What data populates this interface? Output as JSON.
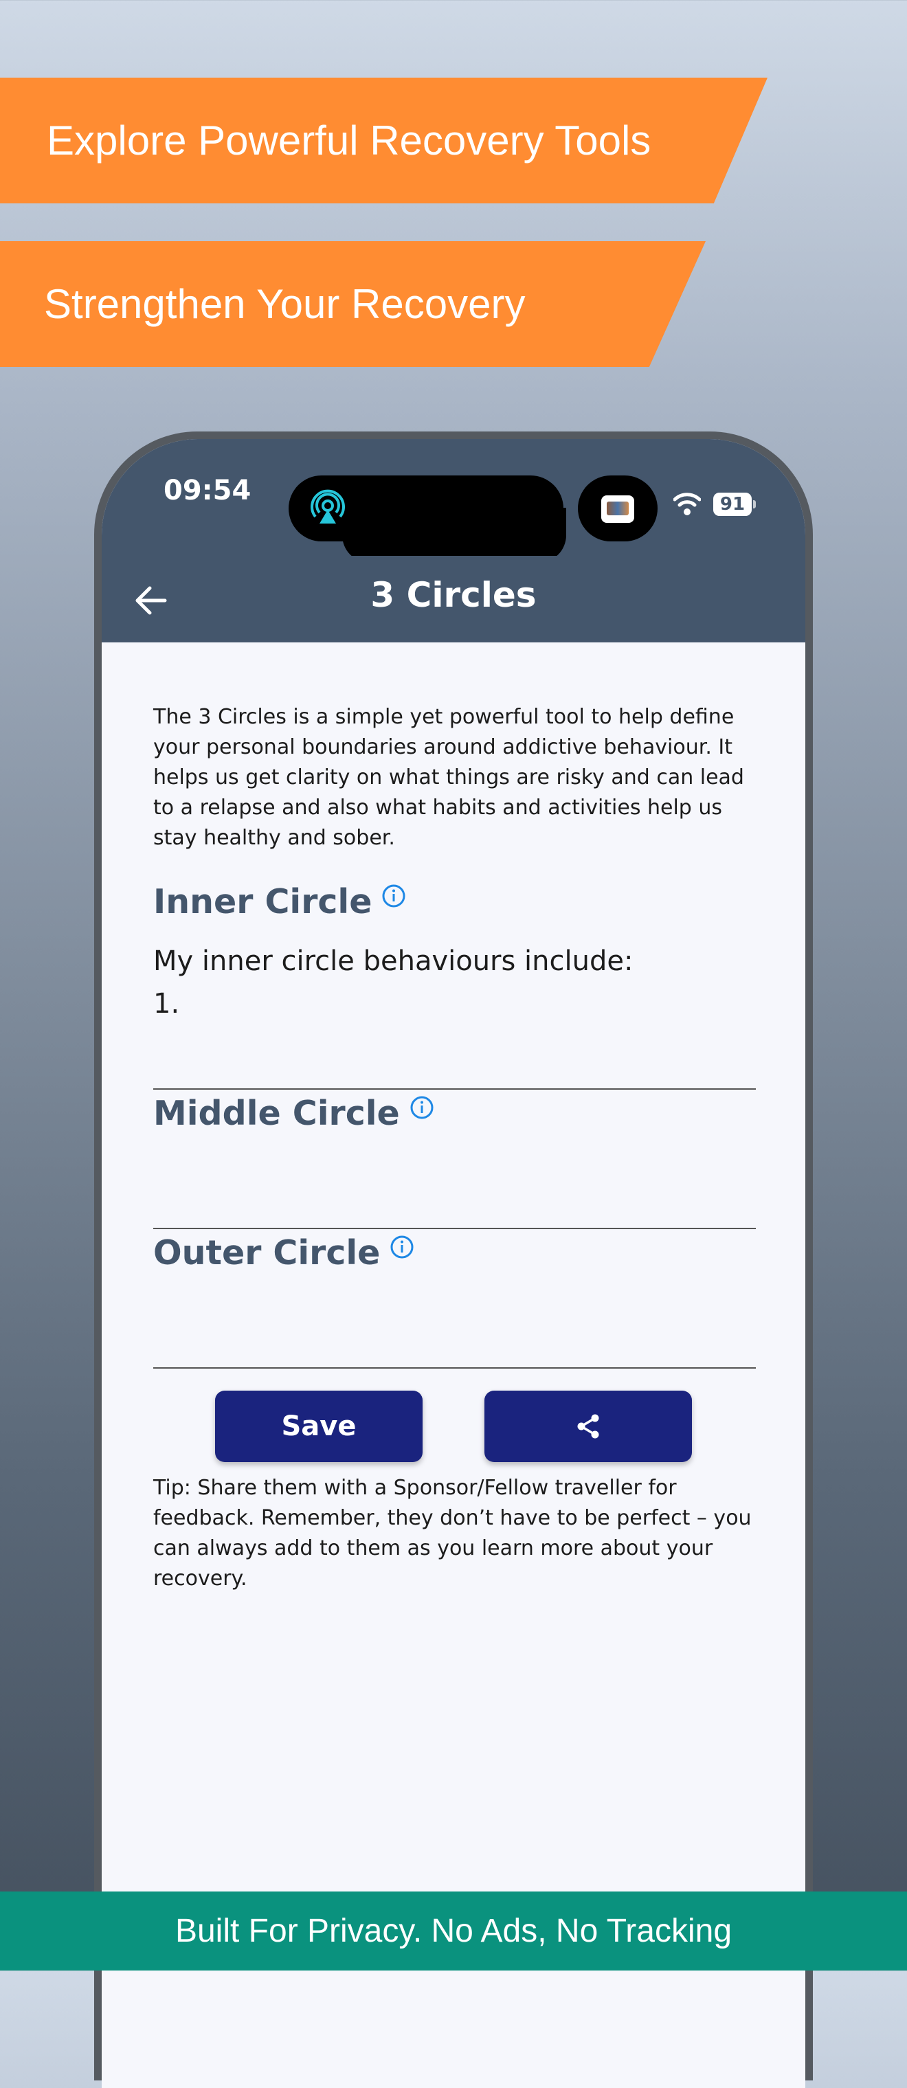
{
  "banners": {
    "top": "Explore Powerful Recovery Tools",
    "second": "Strengthen Your Recovery"
  },
  "status_bar": {
    "time": "09:54",
    "battery": "91"
  },
  "app_bar": {
    "title": "3 Circles",
    "back_icon": "arrow-left-icon"
  },
  "intro": "The 3 Circles is a simple yet powerful tool to help define your personal boundaries around addictive behaviour. It helps us get clarity on what things are risky and can lead to a relapse and also what habits and activities help us stay healthy and sober.",
  "sections": {
    "inner": {
      "heading": "Inner Circle",
      "prompt": "My inner circle behaviours include:",
      "value": "1."
    },
    "middle": {
      "heading": "Middle Circle",
      "value": ""
    },
    "outer": {
      "heading": "Outer Circle",
      "value": ""
    }
  },
  "buttons": {
    "save": "Save",
    "share_icon": "share-icon"
  },
  "tip": "Tip: Share them with a Sponsor/Fellow traveller for feedback. Remember, they don’t have to be perfect – you can always add to them as you learn more about your recovery.",
  "footer": "Built For Privacy. No Ads, No Tracking",
  "colors": {
    "banner": "#ff8c32",
    "app_bar": "#44566c",
    "button": "#1a237e",
    "footer": "#0a927e",
    "info_icon": "#1e88e5"
  }
}
